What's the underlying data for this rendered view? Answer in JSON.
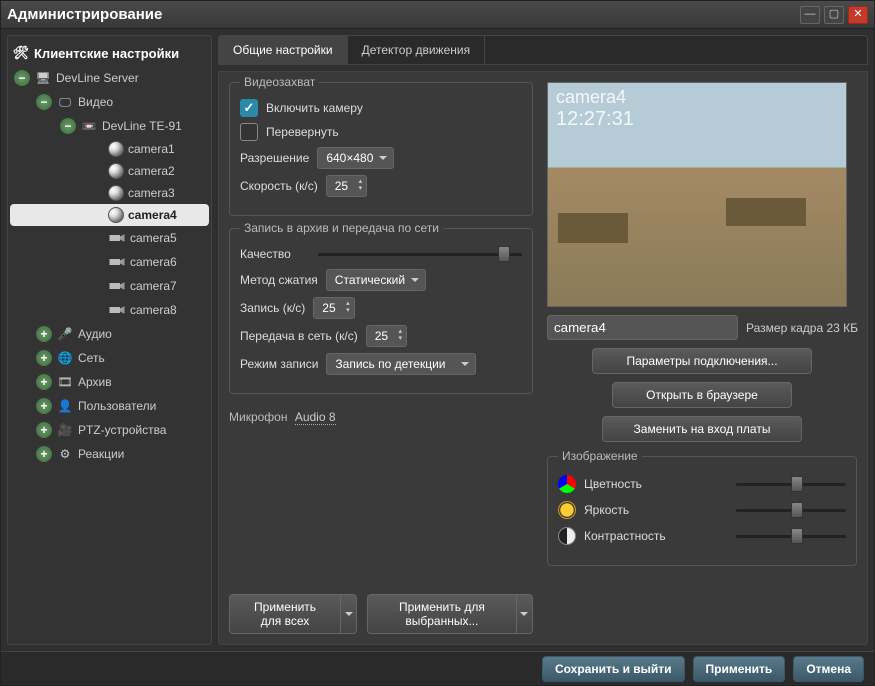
{
  "window": {
    "title": "Администрирование"
  },
  "tree": {
    "root": "Клиентские настройки",
    "server": "DevLine Server",
    "video": "Видео",
    "device": "DevLine TE-91",
    "cameras": [
      "camera1",
      "camera2",
      "camera3",
      "camera4",
      "camera5",
      "camera6",
      "camera7",
      "camera8"
    ],
    "selected_index": 3,
    "audio": "Аудио",
    "network": "Сеть",
    "archive": "Архив",
    "users": "Пользователи",
    "ptz": "PTZ-устройства",
    "reactions": "Реакции"
  },
  "tabs": {
    "general": "Общие настройки",
    "motion": "Детектор движения"
  },
  "capture": {
    "group_label": "Видеозахват",
    "enable_label": "Включить камеру",
    "flip_label": "Перевернуть",
    "resolution_label": "Разрешение",
    "resolution_value": "640×480",
    "fps_label": "Скорость (к/с)",
    "fps_value": "25"
  },
  "record": {
    "group_label": "Запись в архив и передача по сети",
    "quality_label": "Качество",
    "method_label": "Метод сжатия",
    "method_value": "Статический",
    "rec_fps_label": "Запись (к/с)",
    "rec_fps_value": "25",
    "net_fps_label": "Передача в сеть (к/с)",
    "net_fps_value": "25",
    "mode_label": "Режим записи",
    "mode_value": "Запись по детекции"
  },
  "mic": {
    "label": "Микрофон",
    "value": "Audio 8"
  },
  "apply": {
    "all": "Применить для всех",
    "selected": "Применить для выбранных..."
  },
  "preview": {
    "overlay_name": "camera4",
    "overlay_time": "12:27:31",
    "camera_name": "camera4",
    "size_label": "Размер кадра 23 КБ",
    "btn_params": "Параметры подключения...",
    "btn_browser": "Открыть в браузере",
    "btn_replace": "Заменить на вход платы"
  },
  "image": {
    "group_label": "Изображение",
    "color": "Цветность",
    "brightness": "Яркость",
    "contrast": "Контрастность"
  },
  "footer": {
    "save": "Сохранить и выйти",
    "apply": "Применить",
    "cancel": "Отмена"
  }
}
